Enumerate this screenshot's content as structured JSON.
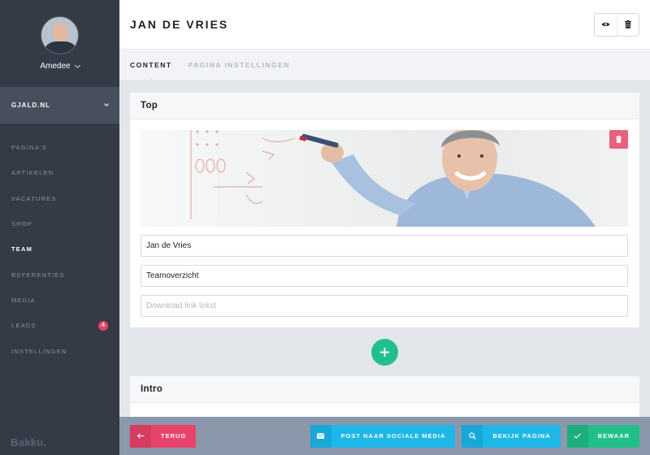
{
  "sidebar": {
    "user_name": "Amedee",
    "site": "GJALD.NL",
    "items": [
      {
        "label": "PAGINA'S"
      },
      {
        "label": "ARTIKELEN"
      },
      {
        "label": "VACATURES"
      },
      {
        "label": "SHOP"
      },
      {
        "label": "TEAM",
        "active": true
      },
      {
        "label": "REFERENTIES"
      },
      {
        "label": "MEDIA"
      },
      {
        "label": "LEADS",
        "badge": "4"
      },
      {
        "label": "INSTELLINGEN"
      }
    ],
    "brand": "Bakku."
  },
  "header": {
    "title": "JAN DE VRIES",
    "actions": [
      {
        "icon": "eye-icon"
      },
      {
        "icon": "trash-icon"
      }
    ]
  },
  "tabs": [
    {
      "label": "CONTENT",
      "active": true
    },
    {
      "label": "PAGINA INSTELLINGEN"
    }
  ],
  "sections": {
    "top": {
      "title": "Top",
      "name_value": "Jan de Vries",
      "subtitle_value": "Teamoverzicht",
      "download_placeholder": "Download link tekst"
    },
    "intro": {
      "title": "Intro"
    }
  },
  "footer": {
    "back_label": "TERUG",
    "social_label": "POST NAAR SOCIALE MEDIA",
    "view_label": "BEKIJK PAGINA",
    "save_label": "BEWAAR"
  },
  "colors": {
    "sidebar": "#343a46",
    "accent_red": "#e8446b",
    "accent_blue": "#1fb6e8",
    "accent_green": "#21c08b"
  }
}
